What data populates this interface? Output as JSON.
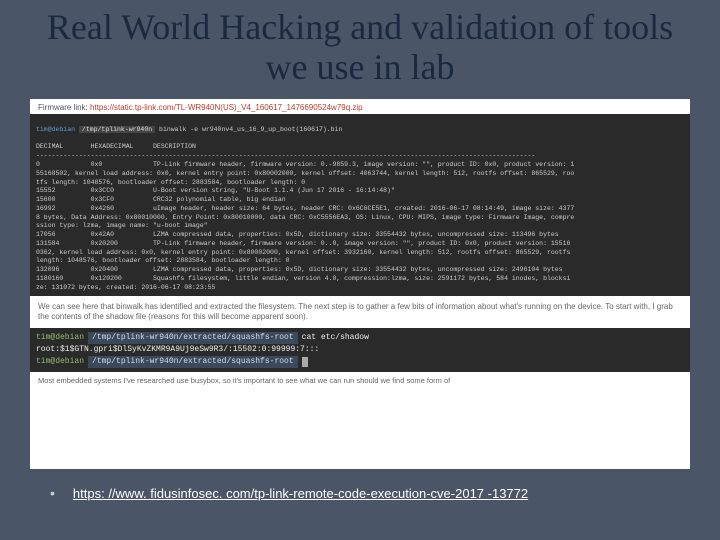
{
  "title": "Real World Hacking and validation of tools we use in lab",
  "firmware": {
    "label": "Firmware link:",
    "url": "https://static.tp-link.com/TL-WR940N(US)_V4_160617_1476690524w79q.zip"
  },
  "terminal1": {
    "prompt_user": "tim@debian",
    "prompt_path": "/tmp/tplink-wr940n",
    "cmd": "binwalk -e wr940nv4_us_16_9_up_boot(160617).bin",
    "header": "DECIMAL       HEXADECIMAL     DESCRIPTION",
    "divider": "--------------------------------------------------------------------------------------------------------------------------------",
    "lines": [
      "0             0x0             TP-Link firmware header, firmware version: 0.-9859.3, image version: \"\", product ID: 0x0, product version: 1",
      "55168502, kernel load address: 0x0, kernel entry point: 0x80002000, kernel offset: 4063744, kernel length: 512, rootfs offset: 865529, roo",
      "tfs length: 1048576, bootloader offset: 2883584, bootloader length: 0",
      "15552         0x3CC0          U-Boot version string, \"U-Boot 1.1.4 (Jun 17 2016 - 16:14:48)\"",
      "15600         0x3CF0          CRC32 polynomial table, big endian",
      "16992         0x4260          uImage header, header size: 64 bytes, header CRC: 0x6C6CE5E1, created: 2016-06-17 08:14:49, image size: 4377",
      "8 bytes, Data Address: 0x80010000, Entry Point: 0x80010000, data CRC: 0xC5556EA3, OS: Linux, CPU: MIPS, image type: Firmware Image, compre",
      "ssion type: lzma, image name: \"u-boot image\"",
      "17056         0x42A0          LZMA compressed data, properties: 0x5D, dictionary size: 33554432 bytes, uncompressed size: 113496 bytes",
      "131584        0x20200         TP-Link firmware header, firmware version: 0..0, image version: \"\", product ID: 0x0, product version: 15516",
      "0362, kernel load address: 0x0, kernel entry point: 0x80002000, kernel offset: 3932160, kernel length: 512, rootfs offset: 865529, rootfs",
      "length: 1048576, bootloader offset: 2883584, bootloader length: 0",
      "132096        0x20400         LZMA compressed data, properties: 0x5D, dictionary size: 33554432 bytes, uncompressed size: 2496104 bytes",
      "1180160       0x120200        Squashfs filesystem, little endian, version 4.0, compression:lzma, size: 2591172 bytes, 584 inodes, blocksi",
      "ze: 131072 bytes, created: 2016-06-17 08:23:55"
    ]
  },
  "article1": "We can see here that binwalk has identified and extracted the filesystem. The next step is to gather a few bits of information about what's running on the device. To start with, I grab the contents of the shadow file (reasons for this will become apparent soon).",
  "terminal2": {
    "user": "tim@debian",
    "path1": "/tmp/tplink-wr940n/extracted/squashfs-root",
    "cmd1": "cat etc/shadow",
    "output": "root:$1$GTN.gpri$DlSyKvZKMR9A9Uj9eSw9R3/:15502:0:99999:7:::",
    "path2": "/tmp/tplink-wr940n/extracted/squashfs-root"
  },
  "article2": "Most embedded systems I've researched use busybox, so it's important to see what we can run should we find some form of",
  "reference": {
    "url": "https: //www. fidusinfosec. com/tp-link-remote-code-execution-cve-2017 -13772"
  }
}
